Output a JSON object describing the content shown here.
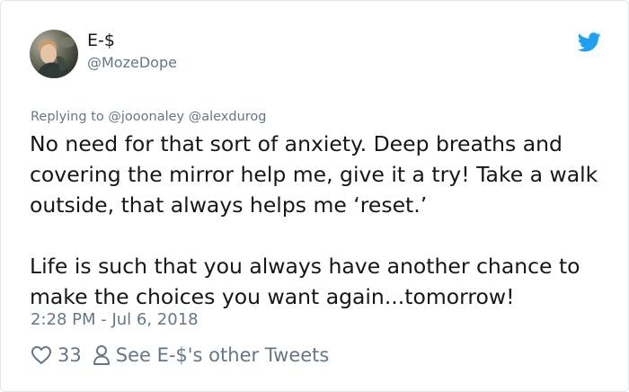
{
  "author": {
    "display_name": "E-$",
    "handle": "@MozeDope"
  },
  "reply": {
    "prefix": "Replying to",
    "mentions": "@jooonaley @alexdurog"
  },
  "tweet": {
    "paragraphs": [
      "No need for that sort of anxiety. Deep breaths and covering the mirror help me, give it a try! Take a walk outside, that always helps me ‘reset.’",
      "Life is such that you always have another chance to make the choices you want again...tomorrow!"
    ],
    "timestamp": "2:28 PM - Jul 6, 2018"
  },
  "actions": {
    "like_count": "33",
    "other_tweets_label": "See E-$'s other Tweets"
  },
  "icons": {
    "brand": "twitter-bird-icon",
    "like": "heart-icon",
    "profile": "person-icon"
  },
  "colors": {
    "brand": "#1da1f2",
    "secondary_text": "#657786",
    "primary_text": "#14171a",
    "border": "#e1e8ed"
  }
}
